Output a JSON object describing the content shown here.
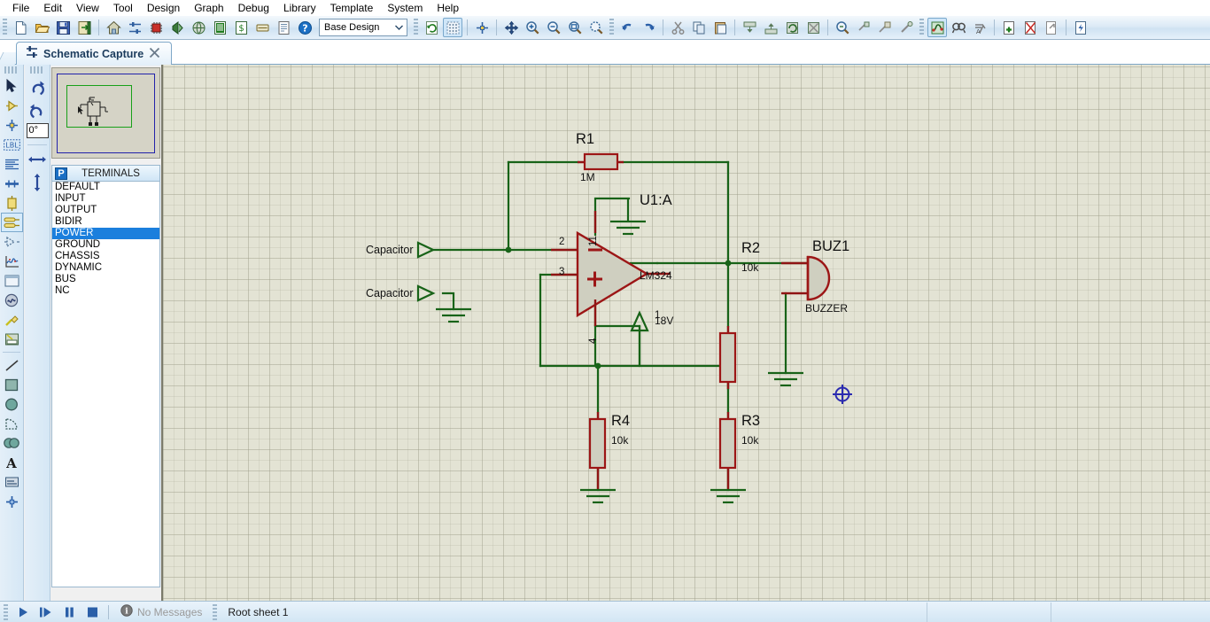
{
  "app": {
    "title": "Schematic Capture"
  },
  "menubar": {
    "items": [
      {
        "label": "File"
      },
      {
        "label": "Edit"
      },
      {
        "label": "View"
      },
      {
        "label": "Tool"
      },
      {
        "label": "Design"
      },
      {
        "label": "Graph"
      },
      {
        "label": "Debug"
      },
      {
        "label": "Library"
      },
      {
        "label": "Template"
      },
      {
        "label": "System"
      },
      {
        "label": "Help"
      }
    ]
  },
  "toolbar": {
    "design_combo": {
      "value": "Base Design",
      "name": "design-sheet-selector"
    },
    "groups": [
      {
        "buttons": [
          "new-file-icon",
          "open-file-icon",
          "save-file-icon",
          "import-export-icon"
        ]
      },
      {
        "buttons": [
          "home-sheet-icon",
          "schematic-capture-icon",
          "pcb-layout-icon",
          "3d-visualizer-icon",
          "design-explorer-icon",
          "bill-of-materials-icon",
          "netlist-icon",
          "bom-report-icon",
          "report-icon",
          "help-icon"
        ]
      },
      {
        "buttons": [
          "refresh-icon",
          "toggle-grid-icon",
          "origin-icon",
          "pan-icon",
          "zoom-in-icon",
          "zoom-out-icon",
          "zoom-all-icon",
          "zoom-area-icon"
        ]
      },
      {
        "buttons": [
          "undo-icon",
          "redo-icon",
          "cut-icon",
          "copy-icon",
          "paste-icon",
          "block-copy-icon",
          "block-move-icon",
          "block-rotate-icon",
          "block-delete-icon",
          "pick-device-icon",
          "make-device-icon",
          "packaging-tool-icon",
          "decompose-icon"
        ]
      },
      {
        "buttons": [
          "wire-autorouter-icon",
          "search-tag-icon",
          "property-assignment-icon",
          "new-sheet-icon",
          "remove-sheet-icon",
          "exit-sheet-icon",
          "design-explorer2-icon"
        ]
      }
    ]
  },
  "tab": {
    "label": "Schematic Capture",
    "close_label": "✕"
  },
  "palette": {
    "items": [
      {
        "name": "selection-mode-icon",
        "selected": false
      },
      {
        "name": "component-mode-icon",
        "selected": false
      },
      {
        "name": "junction-dot-mode-icon",
        "selected": false
      },
      {
        "name": "wire-label-mode-icon",
        "selected": false
      },
      {
        "name": "text-script-mode-icon",
        "selected": false
      },
      {
        "name": "bus-mode-icon",
        "selected": false
      },
      {
        "name": "subcircuit-mode-icon",
        "selected": false
      },
      {
        "name": "terminals-mode-icon",
        "selected": true
      },
      {
        "name": "device-pin-mode-icon",
        "selected": false
      },
      {
        "name": "graph-mode-icon",
        "selected": false
      },
      {
        "name": "tape-recorder-mode-icon",
        "selected": false
      },
      {
        "name": "generator-mode-icon",
        "selected": false
      },
      {
        "name": "voltage-probe-mode-icon",
        "selected": false
      },
      {
        "name": "virtual-instrument-mode-icon",
        "selected": false
      },
      {
        "name": "line-tool-icon",
        "selected": false
      },
      {
        "name": "box-tool-icon",
        "selected": false
      },
      {
        "name": "circle-tool-icon",
        "selected": false
      },
      {
        "name": "arc-tool-icon",
        "selected": false
      },
      {
        "name": "path-tool-icon",
        "selected": false
      },
      {
        "name": "text-tool-icon",
        "selected": false
      },
      {
        "name": "symbol-tool-icon",
        "selected": false
      },
      {
        "name": "marker-tool-icon",
        "selected": false
      }
    ]
  },
  "rotation": {
    "rotate_cw_label": "rotate-clockwise-icon",
    "rotate_ccw_label": "rotate-counterclockwise-icon",
    "angle_value": "0°",
    "mirror_x_label": "mirror-horizontal-icon",
    "mirror_y_label": "mirror-vertical-icon"
  },
  "object_selector": {
    "badge": "P",
    "title": "TERMINALS",
    "items": [
      {
        "label": "DEFAULT",
        "selected": false
      },
      {
        "label": "INPUT",
        "selected": false
      },
      {
        "label": "OUTPUT",
        "selected": false
      },
      {
        "label": "BIDIR",
        "selected": false
      },
      {
        "label": "POWER",
        "selected": true
      },
      {
        "label": "GROUND",
        "selected": false
      },
      {
        "label": "CHASSIS",
        "selected": false
      },
      {
        "label": "DYNAMIC",
        "selected": false
      },
      {
        "label": "BUS",
        "selected": false
      },
      {
        "label": "NC",
        "selected": false
      }
    ]
  },
  "schematic": {
    "colors": {
      "background": "#e3e3d4",
      "wire": "#186318",
      "component_outline": "#9c1616",
      "component_fill": "#cfcfc0",
      "text": "#111111",
      "cursor": "#2b2bb0"
    },
    "components": [
      {
        "ref": "R1",
        "value": "1M",
        "type": "resistor"
      },
      {
        "ref": "R2",
        "value": "10k",
        "type": "resistor"
      },
      {
        "ref": "R3",
        "value": "10k",
        "type": "resistor"
      },
      {
        "ref": "R4",
        "value": "10k",
        "type": "resistor"
      },
      {
        "ref": "U1:A",
        "value": "LM324",
        "type": "opamp"
      },
      {
        "ref": "BUZ1",
        "value": "BUZZER",
        "type": "buzzer"
      }
    ],
    "labels": {
      "r1_ref": "R1",
      "r1_val": "1M",
      "r2_ref": "R2",
      "r2_val": "10k",
      "r3_ref": "R3",
      "r3_val": "10k",
      "r4_ref": "R4",
      "r4_val": "10k",
      "u1_ref": "U1:A",
      "u1_val": "LM324",
      "buz_ref": "BUZ1",
      "buz_val": "BUZZER",
      "supply_18v": "18V",
      "pin11": "11",
      "pin2": "2",
      "pin3": "3",
      "pin4": "4",
      "pin1": "1",
      "opamp_minus": "−",
      "opamp_plus": "+",
      "terminal_cap_1": "Capacitor",
      "terminal_cap_2": "Capacitor"
    }
  },
  "statusbar": {
    "buttons": [
      {
        "name": "play-button",
        "label": "▶",
        "active": false
      },
      {
        "name": "step-button",
        "label": "step",
        "active": true
      },
      {
        "name": "pause-button",
        "label": "pause",
        "active": false
      },
      {
        "name": "stop-button",
        "label": "stop",
        "active": false
      }
    ],
    "message": "No Messages",
    "sheet": "Root sheet 1"
  }
}
